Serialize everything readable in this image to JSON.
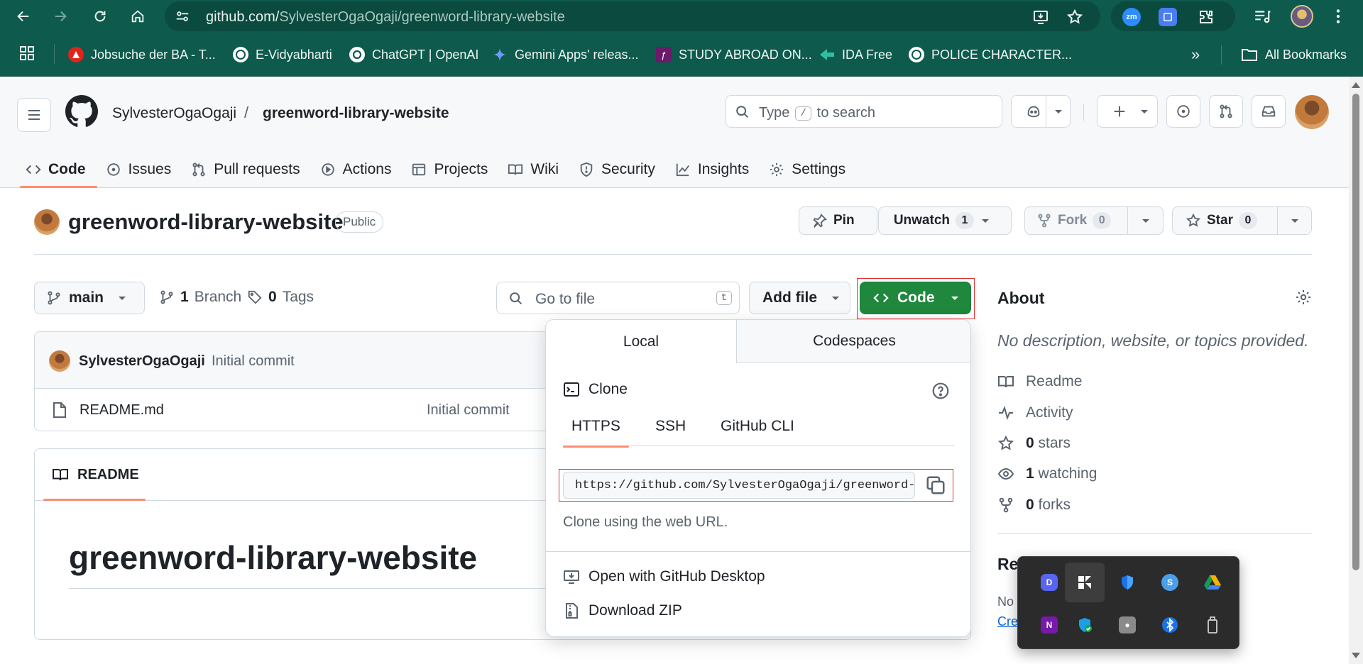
{
  "browser": {
    "url_domain": "github.com/",
    "url_path": "SylvesterOgaOgaji/greenword-library-website",
    "extensions": [
      {
        "name": "zoom-extension-icon",
        "label": "zm",
        "color": "#2d8cff"
      },
      {
        "name": "docs-extension-icon",
        "label": "",
        "color": "#4a7df0"
      }
    ]
  },
  "bookmarks": {
    "items": [
      {
        "label": "Jobsuche der BA - T...",
        "color": "#e2231a"
      },
      {
        "label": "E-Vidyabharti",
        "color": "#ffffff"
      },
      {
        "label": "ChatGPT | OpenAI",
        "color": "#ffffff"
      },
      {
        "label": "Gemini Apps' releas...",
        "color": "#6b9bff"
      },
      {
        "label": "STUDY ABROAD ON...",
        "color": "#6a1b6a"
      },
      {
        "label": "IDA Free",
        "color": "#2fbfa0"
      },
      {
        "label": "POLICE CHARACTER...",
        "color": "#ffffff"
      }
    ],
    "all_bookmarks": "All Bookmarks",
    "overflow": "»"
  },
  "github": {
    "owner": "SylvesterOgaOgaji",
    "separator": "/",
    "repo": "greenword-library-website",
    "search_placeholder_pre": "Type",
    "search_key": "/",
    "search_placeholder_post": "to search",
    "tabs": [
      "Code",
      "Issues",
      "Pull requests",
      "Actions",
      "Projects",
      "Wiki",
      "Security",
      "Insights",
      "Settings"
    ]
  },
  "repo": {
    "title": "greenword-library-website",
    "visibility": "Public",
    "pin": "Pin",
    "unwatch": "Unwatch",
    "watch_count": "1",
    "fork": "Fork",
    "fork_count": "0",
    "star": "Star",
    "star_count": "0"
  },
  "filenav": {
    "branch": "main",
    "branch_count": "1",
    "branch_label": "Branch",
    "tag_count": "0",
    "tag_label": "Tags",
    "goto_placeholder": "Go to file",
    "goto_key": "t",
    "add_file": "Add file",
    "code": "Code"
  },
  "commit": {
    "author": "SylvesterOgaOgaji",
    "message": "Initial commit",
    "files": [
      {
        "name": "README.md",
        "message": "Initial commit"
      }
    ]
  },
  "readme": {
    "tab": "README",
    "heading": "greenword-library-website"
  },
  "about": {
    "title": "About",
    "description": "No description, website, or topics provided.",
    "readme": "Readme",
    "activity": "Activity",
    "stars_count": "0",
    "stars_label": "stars",
    "watching_count": "1",
    "watching_label": "watching",
    "forks_count": "0",
    "forks_label": "forks",
    "releases_partial": "Rel",
    "no_partial": "No",
    "create_partial": "Cre"
  },
  "clone": {
    "tab_local": "Local",
    "tab_codespaces": "Codespaces",
    "clone_label": "Clone",
    "protocols": [
      "HTTPS",
      "SSH",
      "GitHub CLI"
    ],
    "url": "https://github.com/SylvesterOgaOgaji/greenword-library-website.git",
    "hint": "Clone using the web URL.",
    "open_desktop": "Open with GitHub Desktop",
    "download_zip": "Download ZIP"
  },
  "tray": {
    "icons": [
      {
        "name": "discord-icon",
        "color": "#5865f2"
      },
      {
        "name": "windows-widget-icon",
        "color": "#ffffff"
      },
      {
        "name": "defender-icon",
        "color": "#1a73e8"
      },
      {
        "name": "steam-icon",
        "color": "#4a9fe8"
      },
      {
        "name": "google-drive-icon",
        "color": "#f4b400"
      },
      {
        "name": "onenote-icon",
        "color": "#7719aa"
      },
      {
        "name": "security-check-icon",
        "color": "#1a9fe8"
      },
      {
        "name": "photo-app-icon",
        "color": "#8a8a8a"
      },
      {
        "name": "bluetooth-icon",
        "color": "#1a73e8"
      },
      {
        "name": "usb-device-icon",
        "color": "#cfcfcf"
      }
    ]
  }
}
